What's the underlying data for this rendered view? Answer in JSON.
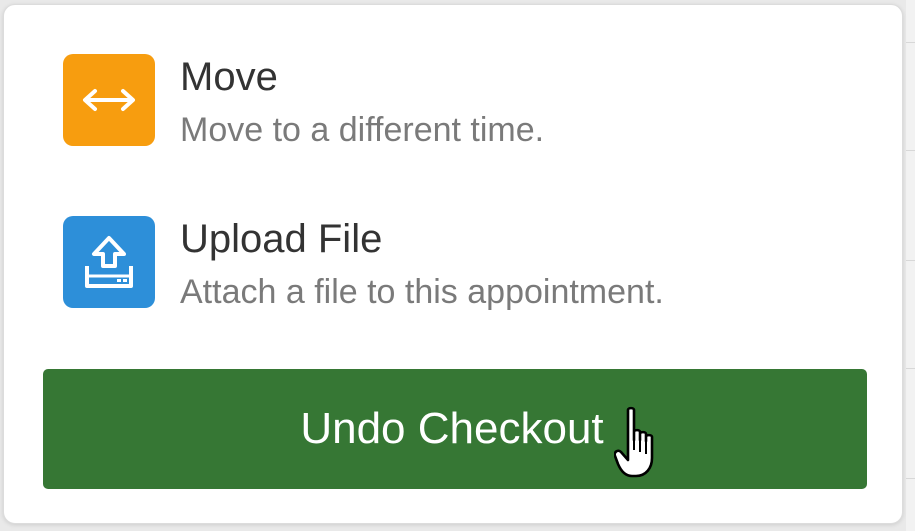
{
  "options": [
    {
      "id": "move",
      "title": "Move",
      "description": "Move to a different time.",
      "icon": "move-arrows-icon",
      "color": "#F79D0F"
    },
    {
      "id": "upload",
      "title": "Upload File",
      "description": "Attach a file to this appointment.",
      "icon": "upload-file-icon",
      "color": "#2D8FD9"
    }
  ],
  "undo_checkout": {
    "label": "Undo Checkout",
    "color": "#367734"
  },
  "cursor": {
    "icon": "hand-pointer-icon"
  }
}
